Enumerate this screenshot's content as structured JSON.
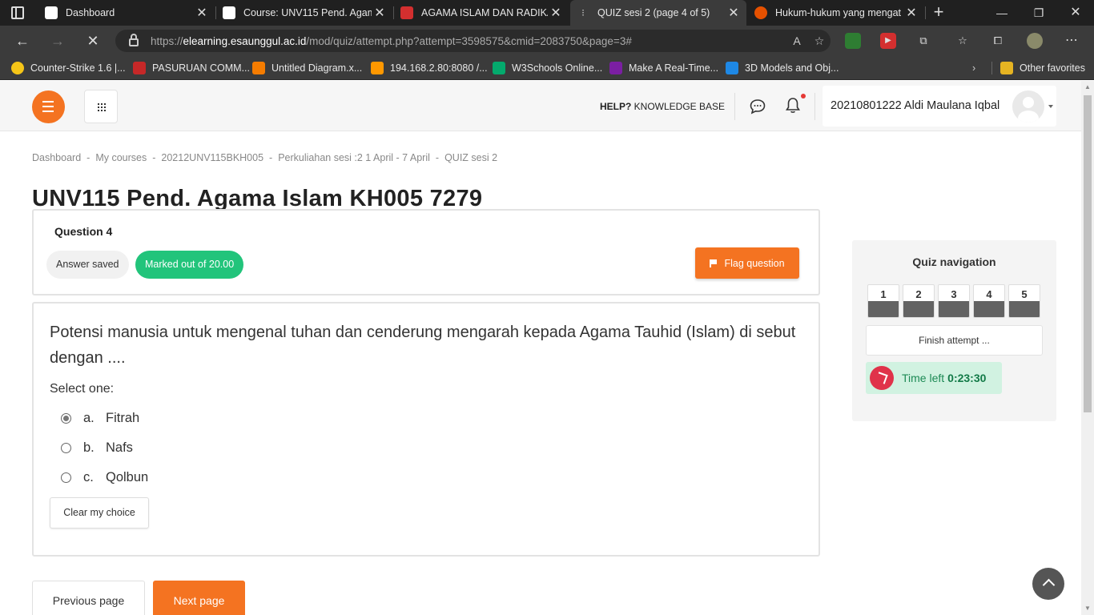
{
  "browser": {
    "tabs": [
      {
        "title": "Dashboard",
        "color": "#ffffff",
        "active": false
      },
      {
        "title": "Course: UNV115 Pend. Agam",
        "color": "#ffffff",
        "active": false
      },
      {
        "title": "AGAMA ISLAM DAN RADIKAL",
        "color": "#d32f2f",
        "active": false
      },
      {
        "title": "QUIZ sesi 2 (page 4 of 5)",
        "color": "#3b3b3b",
        "active": true
      },
      {
        "title": "Hukum-hukum yang mengat",
        "color": "#e65100",
        "active": false
      }
    ],
    "url_prefix": "https://",
    "url_host": "elearning.esaunggul.ac.id",
    "url_path": "/mod/quiz/attempt.php?attempt=3598575&cmid=2083750&page=3#",
    "bookmarks": [
      {
        "label": "Counter-Strike 1.6 |...",
        "color": "#f5c518"
      },
      {
        "label": "PASURUAN COMM...",
        "color": "#c62828"
      },
      {
        "label": "Untitled Diagram.x...",
        "color": "#f57c00"
      },
      {
        "label": "194.168.2.80:8080 /...",
        "color": "#ff9800"
      },
      {
        "label": "W3Schools Online...",
        "color": "#04aa6d"
      },
      {
        "label": "Make A Real-Time...",
        "color": "#7b1fa2"
      },
      {
        "label": "3D Models and Obj...",
        "color": "#1e88e5"
      }
    ],
    "other_favorites": "Other favorites"
  },
  "header": {
    "help_bold": "HELP?",
    "help_text": " KNOWLEDGE BASE",
    "user_name": "20210801222 Aldi Maulana Iqbal"
  },
  "breadcrumb": [
    "Dashboard",
    "My courses",
    "20212UNV115BKH005",
    "Perkuliahan sesi :2 1 April - 7 April",
    "QUIZ sesi 2"
  ],
  "page_title": "UNV115 Pend. Agama Islam KH005 7279",
  "question": {
    "number_label": "Question 4",
    "status": "Answer saved",
    "marks": "Marked out of 20.00",
    "flag_label": "Flag question",
    "text": "Potensi manusia untuk mengenal tuhan dan cenderung mengarah kepada Agama Tauhid (Islam) di sebut dengan ....",
    "prompt": "Select one:",
    "options": [
      {
        "letter": "a.",
        "text": "Fitrah",
        "selected": true
      },
      {
        "letter": "b.",
        "text": "Nafs",
        "selected": false
      },
      {
        "letter": "c.",
        "text": "Qolbun",
        "selected": false
      }
    ],
    "clear_label": "Clear my choice"
  },
  "navigation": {
    "prev_label": "Previous page",
    "next_label": "Next page"
  },
  "quiz_nav": {
    "title": "Quiz navigation",
    "questions": [
      "1",
      "2",
      "3",
      "4",
      "5"
    ],
    "finish_label": "Finish attempt ...",
    "time_label": "Time left",
    "time_value": "0:23:30"
  },
  "colors": {
    "accent": "#f47321",
    "success": "#22c47b",
    "timer_bg": "#d1f2e1"
  }
}
